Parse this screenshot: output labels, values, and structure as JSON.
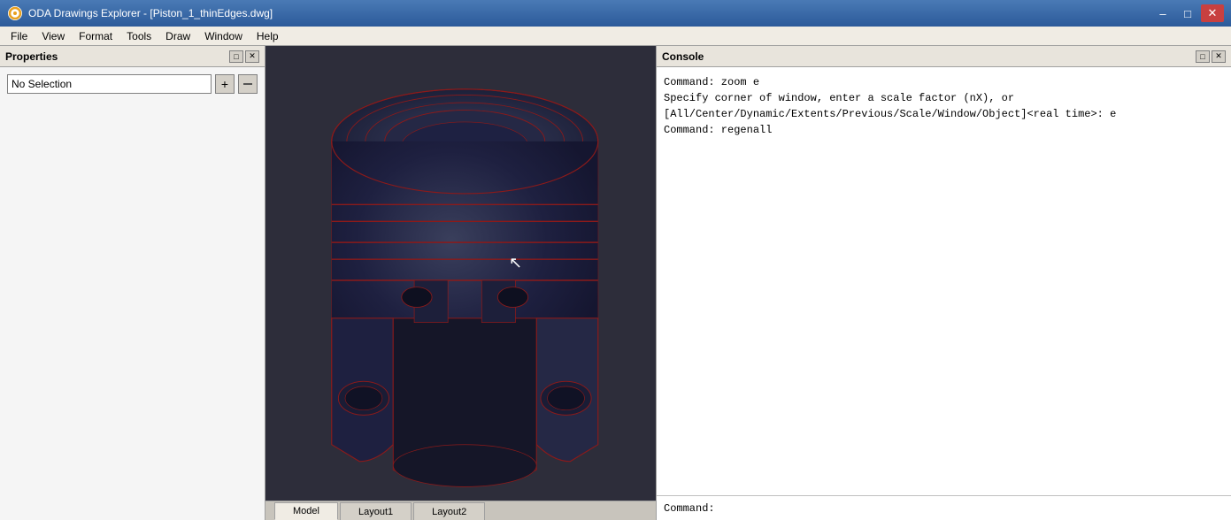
{
  "titleBar": {
    "title": "ODA Drawings Explorer - [Piston_1_thinEdges.dwg]",
    "controls": [
      "minimize",
      "maximize",
      "close"
    ]
  },
  "menuBar": {
    "items": [
      "File",
      "View",
      "Format",
      "Tools",
      "Draw",
      "Window",
      "Help"
    ]
  },
  "propertiesPanel": {
    "title": "Properties",
    "selectionOptions": [
      "No Selection"
    ],
    "selectedValue": "No Selection",
    "addButtonLabel": "+",
    "removeButtonLabel": "✕"
  },
  "tabs": [
    {
      "label": "Model",
      "active": true
    },
    {
      "label": "Layout1",
      "active": false
    },
    {
      "label": "Layout2",
      "active": false
    }
  ],
  "consolePanel": {
    "title": "Console",
    "lines": [
      {
        "text": "Command: zoom e"
      },
      {
        "text": "Specify corner of window, enter a scale factor (nX), or"
      },
      {
        "text": "[All/Center/Dynamic/Extents/Previous/Scale/Window/Object]<real time>: e"
      },
      {
        "text": "Command: regenall"
      },
      {
        "text": ""
      },
      {
        "text": ""
      },
      {
        "text": ""
      },
      {
        "text": ""
      },
      {
        "text": ""
      },
      {
        "text": ""
      },
      {
        "text": ""
      },
      {
        "text": ""
      },
      {
        "text": ""
      },
      {
        "text": ""
      },
      {
        "text": ""
      },
      {
        "text": ""
      },
      {
        "text": ""
      },
      {
        "text": ""
      },
      {
        "text": ""
      },
      {
        "text": ""
      },
      {
        "text": ""
      },
      {
        "text": ""
      },
      {
        "text": ""
      },
      {
        "text": ""
      },
      {
        "text": ""
      }
    ],
    "commandPrompt": "Command:"
  },
  "piston": {
    "color": "#1e2040",
    "edgeColor": "#8b1a1a"
  }
}
